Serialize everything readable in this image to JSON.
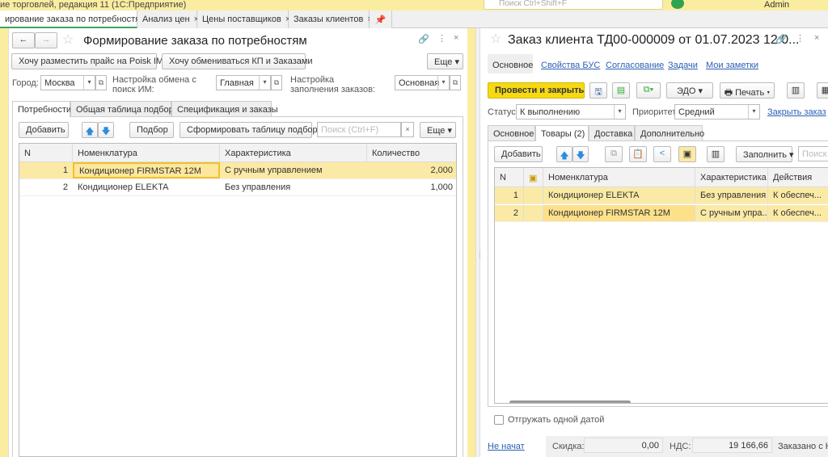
{
  "app": {
    "title": "ие торговлей, редакция 11  (1С:Предприятие)",
    "search_placeholder": "Поиск Ctrl+Shift+F",
    "user": "Admin"
  },
  "open_tabs": [
    {
      "label": "ирование заказа по потребностям",
      "active": true
    },
    {
      "label": "Анализ цен"
    },
    {
      "label": "Цены поставщиков"
    },
    {
      "label": "Заказы клиентов"
    }
  ],
  "left": {
    "title": "Формирование заказа по потребностям",
    "buttons": {
      "price": "Хочу разместить прайс на Poisk IM",
      "exchange": "Хочу обмениваться КП и Заказами",
      "more": "Еще ▾"
    },
    "fields": {
      "city_label": "Город:",
      "city": "Москва",
      "exchange_label": "Настройка обмена с поиск ИМ:",
      "exchange": "Главная",
      "fill_label": "Настройка заполнения заказов:",
      "fill": "Основная"
    },
    "tabs": [
      "Потребности",
      "Общая таблица подбора",
      "Спецификация и заказы"
    ],
    "toolbar": {
      "add": "Добавить",
      "pick": "Подбор",
      "build": "Сформировать таблицу подбора",
      "search_placeholder": "Поиск (Ctrl+F)",
      "more": "Еще ▾"
    },
    "columns": [
      "N",
      "Номенклатура",
      "Характеристика",
      "Количество"
    ],
    "rows": [
      [
        "1",
        "Кондиционер FIRMSTAR 12M",
        "С ручным управлением",
        "2,000"
      ],
      [
        "2",
        "Кондиционер ELEKTA",
        "Без управления",
        "1,000"
      ]
    ]
  },
  "right": {
    "title": "Заказ клиента ТД00-000009 от 01.07.2023 12:0...",
    "nav": [
      "Основное",
      "Свойства БУС",
      "Согласование",
      "Задачи",
      "Мои заметки"
    ],
    "toolbar": {
      "post_close": "Провести и закрыть",
      "edo": "ЭДО ▾",
      "print": "Печать ▾"
    },
    "status_label": "Статус:",
    "status": "К выполнению",
    "priority_label": "Приоритет:",
    "priority": "Средний",
    "close_order": "Закрыть заказ",
    "tabs": [
      "Основное",
      "Товары (2)",
      "Доставка",
      "Дополнительно"
    ],
    "goods_toolbar": {
      "add": "Добавить",
      "fill": "Заполнить ▾",
      "search_placeholder": "Поиск (Ctrl+F)"
    },
    "columns": [
      "N",
      "",
      "Номенклатура",
      "Характеристика",
      "Действия"
    ],
    "rows": [
      [
        "1",
        "",
        "Кондиционер ELEKTA",
        "Без управления",
        "К обеспеч..."
      ],
      [
        "2",
        "",
        "Кондиционер FIRMSTAR 12M",
        "С ручным упра...",
        "К обеспеч..."
      ]
    ],
    "ship_one_date": "Отгружать одной датой",
    "footer": {
      "state": "Не начат",
      "discount_label": "Скидка:",
      "discount": "0,00",
      "vat_label": "НДС:",
      "vat": "19 166,66",
      "ordered_label": "Заказано с НД"
    }
  },
  "colors": {
    "accent_yellow": "#f5d915",
    "selection": "#fbeaa5",
    "tab_active": "#3ba55c",
    "link": "#2b5fb4"
  }
}
